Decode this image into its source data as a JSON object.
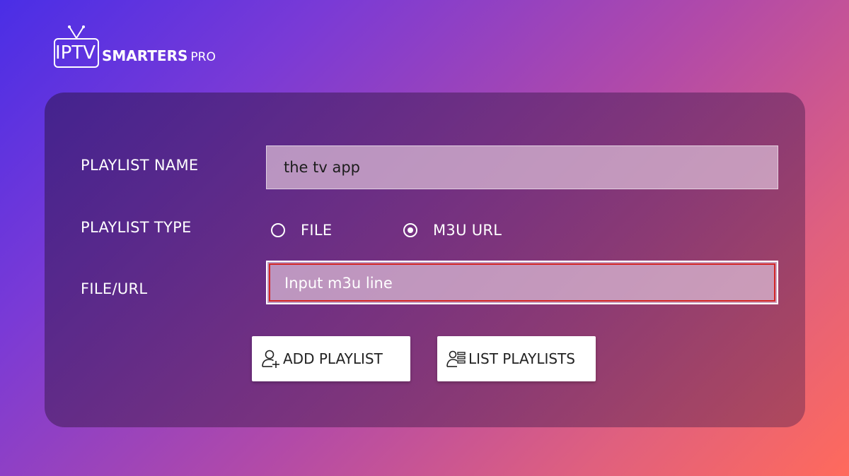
{
  "brand": {
    "logo_iptv": "IPTV",
    "logo_smarters": "SMARTERS",
    "logo_pro": "PRO"
  },
  "form": {
    "playlist_name_label": "PLAYLIST NAME",
    "playlist_name_value": "the tv app",
    "playlist_type_label": "PLAYLIST TYPE",
    "type_options": [
      {
        "label": "FILE",
        "checked": false
      },
      {
        "label": "M3U URL",
        "checked": true
      }
    ],
    "file_url_label": "FILE/URL",
    "file_url_placeholder": "Input m3u line"
  },
  "actions": {
    "add_playlist": "ADD PLAYLIST",
    "list_playlists": "LIST PLAYLISTS"
  },
  "colors": {
    "focus_outline": "#d32626",
    "button_bg": "#ffffff"
  },
  "icons": {
    "add_playlist_icon": "user-plus-icon",
    "list_playlists_icon": "user-list-icon",
    "logo_icon": "tv-antenna-icon"
  }
}
